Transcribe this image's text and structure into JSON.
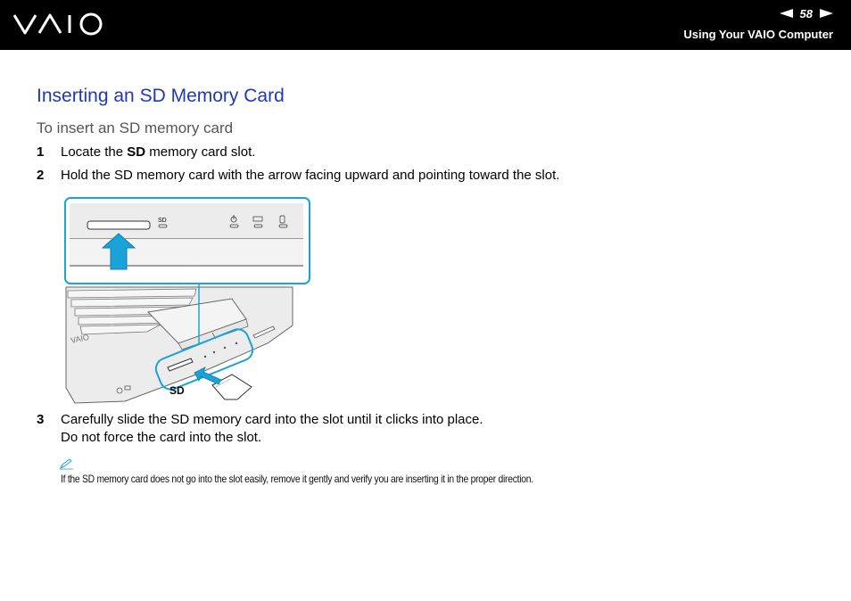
{
  "header": {
    "logo_text": "VAIO",
    "page_number": "58",
    "section": "Using Your VAIO Computer"
  },
  "content": {
    "title": "Inserting an SD Memory Card",
    "subtitle": "To insert an SD memory card",
    "steps": [
      {
        "num": "1",
        "pre": "Locate the ",
        "bold": "SD",
        "post": " memory card slot."
      },
      {
        "num": "2",
        "text": "Hold the SD memory card with the arrow facing upward and pointing toward the slot."
      },
      {
        "num": "3",
        "text": "Carefully slide the SD memory card into the slot until it clicks into place.",
        "line2": "Do not force the card into the slot."
      }
    ],
    "note": "If the SD memory card does not go into the slot easily, remove it gently and verify you are inserting it in the proper direction."
  },
  "illustration": {
    "slot_label": "SD",
    "callout_label": "SD",
    "accent_color": "#1aa3d9",
    "arrow_color": "#1aa3d9"
  }
}
